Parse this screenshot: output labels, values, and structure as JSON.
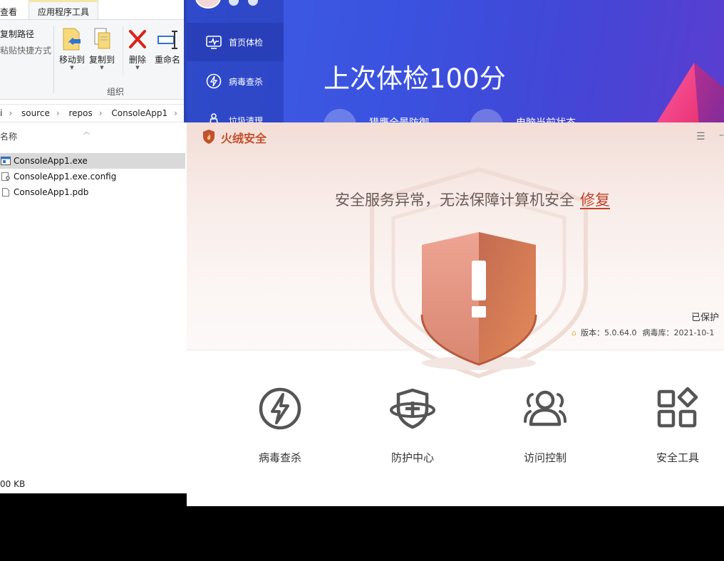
{
  "explorer": {
    "tabs": {
      "view": "查看",
      "app_tools": "应用程序工具"
    },
    "ribbon": {
      "copy_path": "复制路径",
      "paste_shortcut": "粘贴快捷方式",
      "move_to": "移动到",
      "copy_to": "复制到",
      "delete": "删除",
      "rename": "重命名",
      "group_label": "组织"
    },
    "address": [
      "i",
      "source",
      "repos",
      "ConsoleApp1",
      "C"
    ],
    "column_name": "名称",
    "files": [
      {
        "name": "ConsoleApp1.exe",
        "icon": "exe-file-icon",
        "selected": true
      },
      {
        "name": "ConsoleApp1.exe.config",
        "icon": "config-file-icon",
        "selected": false
      },
      {
        "name": "ConsoleApp1.pdb",
        "icon": "file-icon",
        "selected": false
      }
    ],
    "status": "00 KB"
  },
  "huorong_bg": {
    "nav": [
      {
        "label": "首页体检",
        "icon": "pulse-icon",
        "active": true
      },
      {
        "label": "病毒查杀",
        "icon": "lightning-icon",
        "active": false
      },
      {
        "label": "垃圾清理",
        "icon": "broom-icon",
        "active": false
      }
    ],
    "headline": "上次体检100分",
    "sub1": "猎鹰全景防御",
    "sub2": "电脑当前状态"
  },
  "huorong_popup": {
    "brand": "火绒安全",
    "warning_text": "安全服务异常，无法保障计算机安全",
    "repair_link": "修复",
    "protected": "已保护",
    "version_label": "版本：5.0.64.0",
    "virus_db_label": "病毒库：2021-10-1",
    "features": [
      {
        "label": "病毒查杀",
        "icon": "lightning-circle-icon"
      },
      {
        "label": "防护中心",
        "icon": "shield-plus-icon"
      },
      {
        "label": "访问控制",
        "icon": "users-icon"
      },
      {
        "label": "安全工具",
        "icon": "grid-tools-icon"
      }
    ],
    "colors": {
      "brand": "#c2502a",
      "shield_light": "#eea493",
      "shield_dark": "#d9734f",
      "link": "#c0422a"
    }
  }
}
